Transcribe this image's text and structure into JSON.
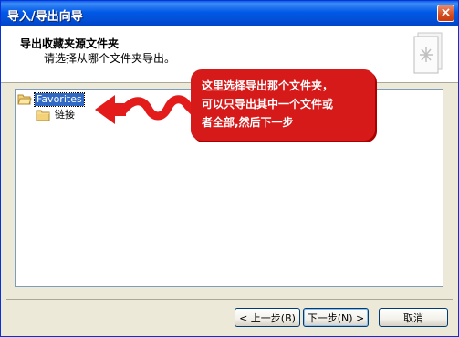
{
  "window": {
    "title": "导入/导出向导",
    "close_glyph": "×"
  },
  "header": {
    "title": "导出收藏夹源文件夹",
    "subtitle": "请选择从哪个文件夹导出。",
    "icon": "wizard-page-icon"
  },
  "tree": {
    "items": [
      {
        "label": "Favorites",
        "selected": true,
        "icon": "folder-open-icon"
      },
      {
        "label": "链接",
        "selected": false,
        "icon": "folder-icon"
      }
    ]
  },
  "callout": {
    "lines": [
      "这里选择导出那个文件夹，",
      "可以只导出其中一个文件或",
      "者全部,然后下一步"
    ],
    "color": "#d61a1a",
    "pointer": "red-wavy-arrow"
  },
  "buttons": {
    "back": "< 上一步(B)",
    "next": "下一步(N) >",
    "cancel": "取消"
  },
  "colors": {
    "titlebar": "#0058e6",
    "face": "#ece9d8",
    "selection": "#316ac5"
  }
}
